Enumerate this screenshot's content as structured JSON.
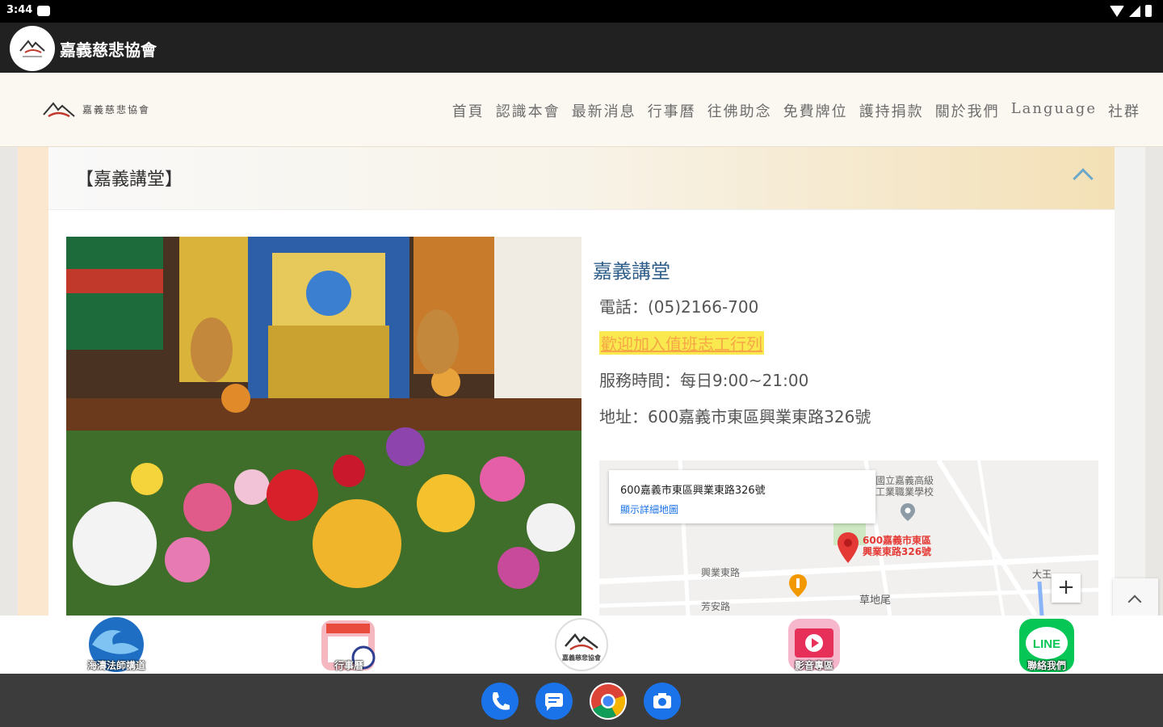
{
  "status_bar": {
    "time": "3:44"
  },
  "app_bar": {
    "title": "嘉義慈悲協會"
  },
  "site": {
    "logo_text": "嘉義慈悲協會",
    "nav": [
      "首頁",
      "認識本會",
      "最新消息",
      "行事曆",
      "往佛助念",
      "免費牌位",
      "護持捐款",
      "關於我們",
      "Language",
      "社群"
    ]
  },
  "section": {
    "title": "【嘉義講堂】",
    "place_name": "嘉義講堂",
    "phone": "電話：(05)2166-700",
    "volunteer_link": "歡迎加入值班志工行列",
    "hours": "服務時間：每日9:00~21:00",
    "address": "地址：600嘉義市東區興業東路326號"
  },
  "map": {
    "card_address": "600嘉義市東區興業東路326號",
    "card_link": "顯示詳細地圖",
    "pin_label_1": "600嘉義市東區",
    "pin_label_2": "興業東路326號",
    "school_label_1": "國立嘉義高級",
    "school_label_2": "工業職業學校",
    "road_labels": [
      "興業東路",
      "芳安路",
      "草地尾",
      "大王"
    ],
    "zoom_in": "+"
  },
  "tabs": [
    {
      "label": "海濤法師講道",
      "color": "#1e6fc4"
    },
    {
      "label": "行事曆",
      "color": "#e94b3c"
    },
    {
      "label": "嘉義慈悲協會",
      "color": "#ffffff"
    },
    {
      "label": "影音專區",
      "color": "#e6305a"
    },
    {
      "label": "聯絡我們",
      "color": "#06c755"
    }
  ],
  "tab_texts": {
    "line": "LINE"
  },
  "colors": {
    "accent": "#2f5f8a",
    "highlight": "#f9e84e",
    "link": "#f6a646"
  }
}
